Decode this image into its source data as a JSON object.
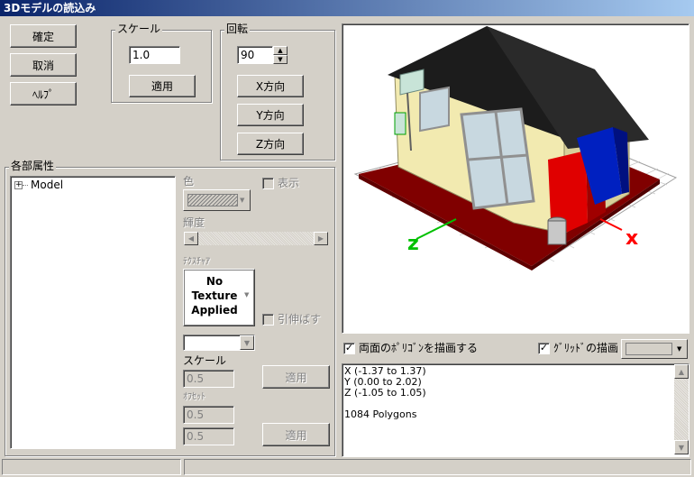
{
  "window": {
    "title": "3Dモデルの読込み"
  },
  "buttons": {
    "confirm": "確定",
    "cancel": "取消",
    "help": "ﾍﾙﾌﾟ"
  },
  "scale_group": {
    "title": "スケール",
    "value": "1.0",
    "apply": "適用"
  },
  "rotate_group": {
    "title": "回転",
    "value": "90",
    "x_dir": "X方向",
    "y_dir": "Y方向",
    "z_dir": "Z方向"
  },
  "attributes": {
    "title": "各部属性",
    "tree_root": "Model",
    "color_label": "色",
    "display_label": "表示",
    "brightness_label": "輝度",
    "texture_label": "ﾃｸｽﾁｬｱ",
    "texture_preview": [
      "No",
      "Texture",
      "Applied"
    ],
    "stretch_label": "引伸ばす",
    "scale_label": "スケール",
    "scale_value": "0.5",
    "apply": "適用",
    "offset_label": "ｵﾌｾｯﾄ",
    "offset_x": "0.5",
    "offset_y": "0.5",
    "apply2": "適用"
  },
  "viewport": {
    "axis_x": "x",
    "axis_z": "z",
    "colors": {
      "background": "#ffffff",
      "ground": "#800000",
      "wall": "#f2eab0",
      "roof": "#1c1c1c",
      "red_box": "#e00000",
      "blue_box": "#0020c0",
      "x_axis": "#ff0000",
      "z_axis": "#00c000"
    }
  },
  "options": {
    "double_sided": "両面のﾎﾟﾘｺﾞﾝを描画する",
    "double_sided_checked": true,
    "grid": "ｸﾞﾘｯﾄﾞの描画",
    "grid_checked": true
  },
  "info": {
    "x_range": "X (-1.37 to 1.37)",
    "y_range": "Y (0.00 to 2.02)",
    "z_range": "Z (-1.05 to 1.05)",
    "polygons": "1084 Polygons"
  }
}
